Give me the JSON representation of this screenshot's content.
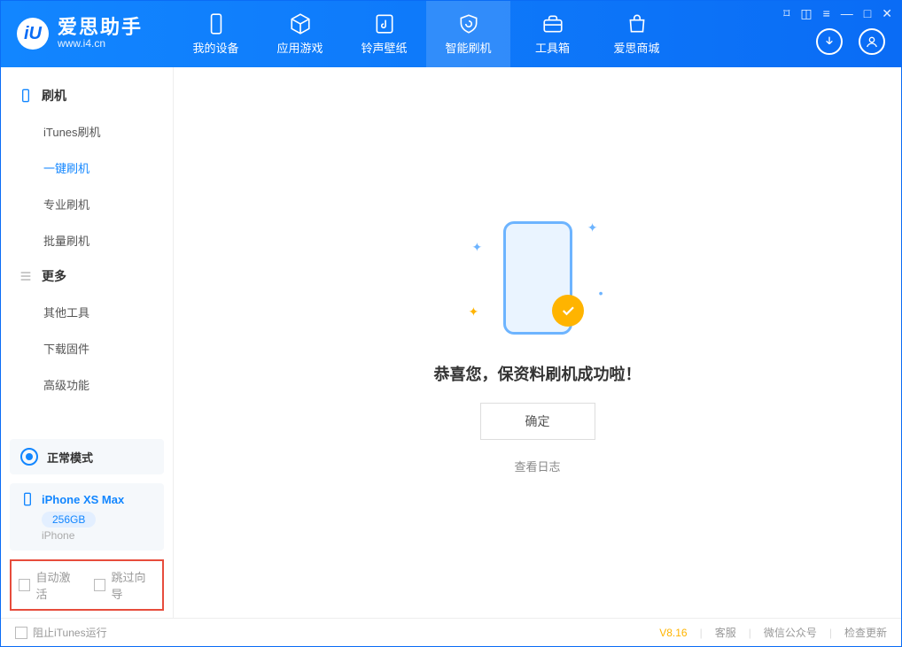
{
  "logo": {
    "title": "爱思助手",
    "subtitle": "www.i4.cn"
  },
  "tabs": [
    {
      "label": "我的设备"
    },
    {
      "label": "应用游戏"
    },
    {
      "label": "铃声壁纸"
    },
    {
      "label": "智能刷机"
    },
    {
      "label": "工具箱"
    },
    {
      "label": "爱思商城"
    }
  ],
  "sidebar": {
    "group_flash": "刷机",
    "flash_items": [
      "iTunes刷机",
      "一键刷机",
      "专业刷机",
      "批量刷机"
    ],
    "active_flash_index": 1,
    "group_more": "更多",
    "more_items": [
      "其他工具",
      "下载固件",
      "高级功能"
    ]
  },
  "mode_panel": {
    "label": "正常模式"
  },
  "device_panel": {
    "name": "iPhone XS Max",
    "capacity": "256GB",
    "subtype": "iPhone"
  },
  "options": {
    "auto_activate": "自动激活",
    "skip_guide": "跳过向导"
  },
  "main": {
    "success_msg": "恭喜您，保资料刷机成功啦！",
    "ok_label": "确定",
    "view_log": "查看日志"
  },
  "footer": {
    "block_itunes": "阻止iTunes运行",
    "version": "V8.16",
    "links": [
      "客服",
      "微信公众号",
      "检查更新"
    ]
  },
  "colors": {
    "brand": "#1286ff",
    "accent": "#ffb400"
  }
}
